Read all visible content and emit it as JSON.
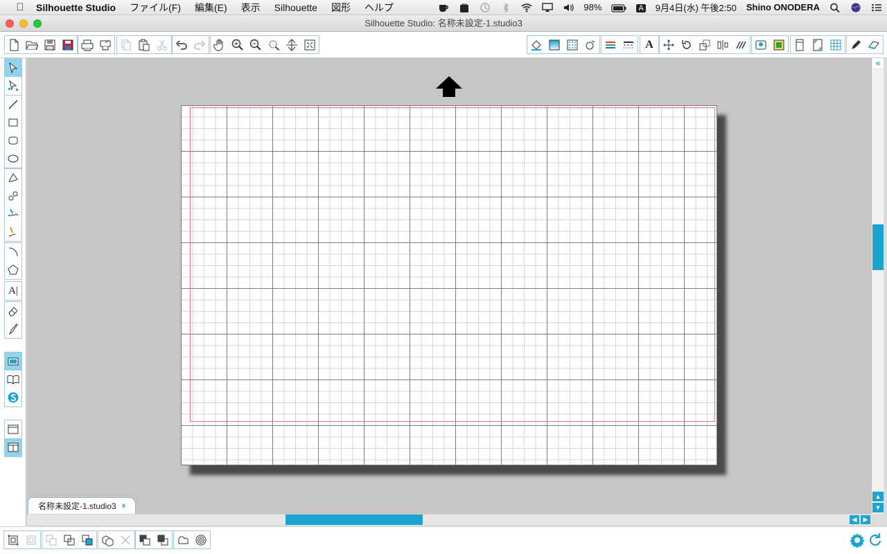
{
  "menubar": {
    "app_name": "Silhouette Studio",
    "items": [
      "ファイル(F)",
      "編集(E)",
      "表示",
      "Silhouette",
      "図形",
      "ヘルプ"
    ],
    "battery": "98%",
    "input_method": "A",
    "clock": "9月4日(水) 午後2:50",
    "user": "Shino ONODERA"
  },
  "window": {
    "title": "Silhouette Studio: 名称未設定-1.studio3"
  },
  "document_tab": {
    "label": "名称未設定-1.studio3",
    "close": "x"
  },
  "colors": {
    "accent": "#1ba3d3",
    "cut_border": "#e8707a",
    "canvas_bg": "#c6c6c6"
  }
}
